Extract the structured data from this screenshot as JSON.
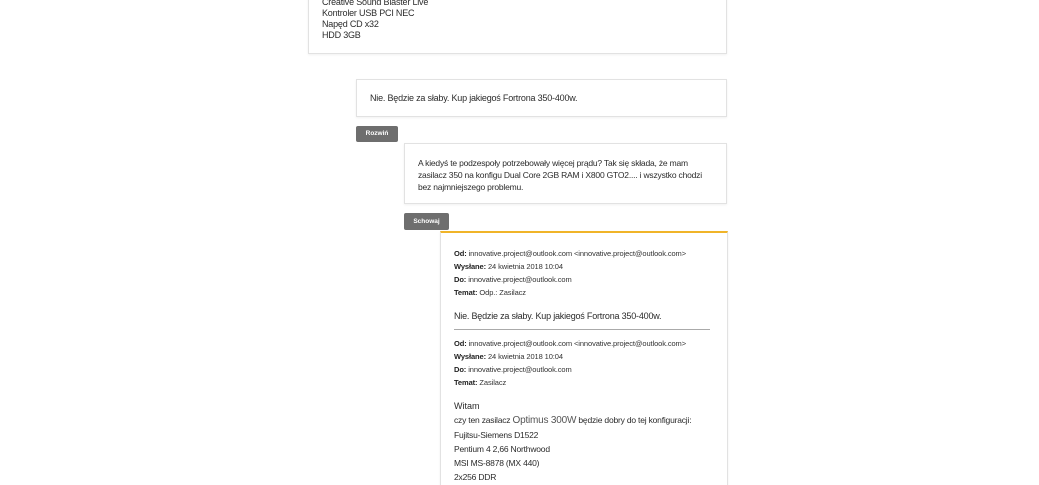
{
  "top_card": {
    "lines": [
      "Creative Sound Blaster Live",
      "Kontroler USB PCI NEC",
      "Napęd CD x32",
      "HDD 3GB"
    ]
  },
  "reply1": {
    "text": "Nie. Będzie za słaby. Kup jakiegoś Fortrona 350-400w."
  },
  "expand_button": {
    "label": "Rozwiń"
  },
  "reply2": {
    "text": "A kiedyś te podzespoły potrzebowały więcej prądu? Tak się składa, że mam zasilacz 350 na konfigu Dual Core 2GB RAM i X800 GTO2.... i wszystko chodzi bez najmniejszego problemu."
  },
  "hide_button": {
    "label": "Schowaj"
  },
  "email": {
    "header1": {
      "from_label": "Od:",
      "from": "innovative.project@outlook.com <innovative.project@outlook.com>",
      "sent_label": "Wysłane:",
      "sent": "24 kwietnia 2018 10:04",
      "to_label": "Do:",
      "to": "innovative.project@outlook.com",
      "subject_label": "Temat:",
      "subject": "Odp.: Zasilacz"
    },
    "quote": "Nie. Będzie za słaby. Kup jakiegoś Fortrona 350-400w.",
    "header2": {
      "from_label": "Od:",
      "from": "innovative.project@outlook.com <innovative.project@outlook.com>",
      "sent_label": "Wysłane:",
      "sent": "24 kwietnia 2018 10:04",
      "to_label": "Do:",
      "to": "innovative.project@outlook.com",
      "subject_label": "Temat:",
      "subject": "Zasilacz"
    },
    "greeting": "Witam",
    "question_prefix": "czy ten zasilacz",
    "psu_model": "Optimus 300W",
    "question_suffix": "będzie dobry do tej konfiguracji:",
    "config": [
      "Fujitsu-Siemens D1522",
      "Pentium 4 2,66 Northwood",
      "MSI MS-8878 (MX 440)",
      "2x256 DDR"
    ]
  },
  "colors": {
    "accent": "#f0b429",
    "button_bg": "#6e6e6e"
  }
}
